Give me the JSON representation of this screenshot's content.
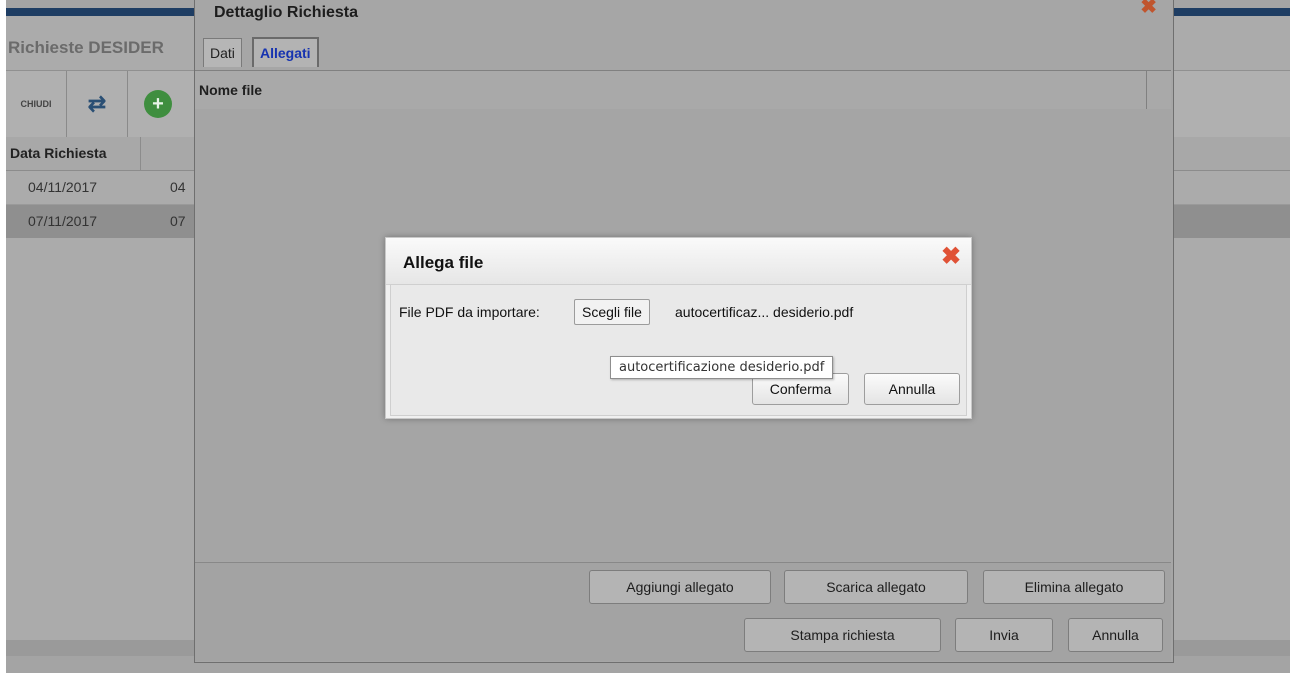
{
  "background": {
    "title": "Richieste DESIDER",
    "toolbar": {
      "chiudi_label": "CHIUDI",
      "refresh_icon": "⇄",
      "add_icon": "+"
    },
    "table": {
      "header": [
        "Data Richiesta",
        ""
      ],
      "rows": [
        [
          "04/11/2017",
          "04"
        ],
        [
          "07/11/2017",
          "07"
        ]
      ]
    }
  },
  "dialog": {
    "title": "Dettaglio Richiesta",
    "close_icon": "✖",
    "tabs": [
      {
        "label": "Dati",
        "active": false
      },
      {
        "label": "Allegati",
        "active": true
      }
    ],
    "grid": {
      "column_header": "Nome file"
    },
    "attachment_buttons": {
      "add": "Aggiungi allegato",
      "download": "Scarica allegato",
      "delete": "Elimina allegato"
    },
    "footer_buttons": {
      "print": "Stampa richiesta",
      "send": "Invia",
      "cancel": "Annulla"
    }
  },
  "modal": {
    "title": "Allega file",
    "close_icon": "✖",
    "label": "File PDF da importare:",
    "choose_button": "Scegli file",
    "selected_file": "autocertificaz... desiderio.pdf",
    "confirm_button": "Conferma",
    "cancel_button": "Annulla",
    "tooltip": "autocertificazione desiderio.pdf"
  },
  "colors": {
    "accent_tab": "#1633b0",
    "close": "#e05236",
    "add_green": "#3f8e3f",
    "top_bar": "#1e3d63"
  }
}
